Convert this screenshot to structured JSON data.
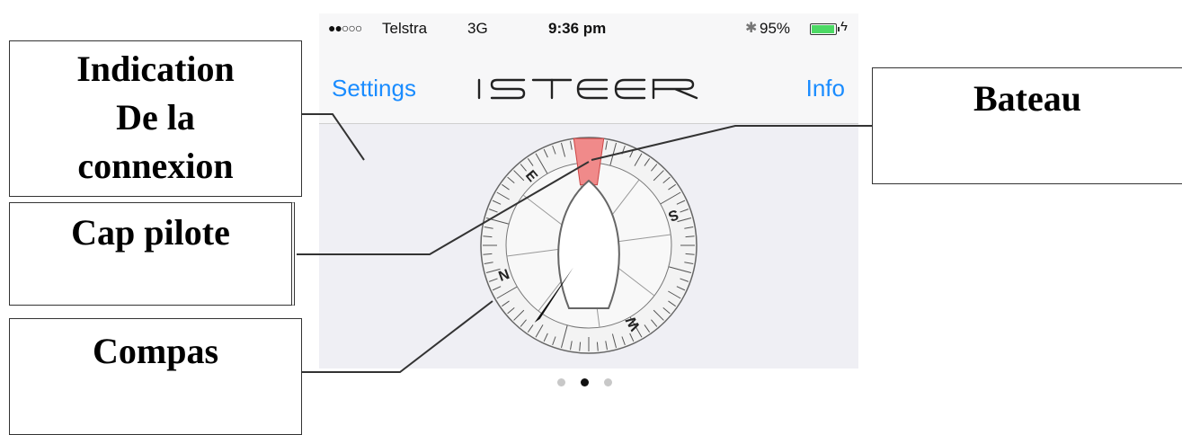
{
  "status_bar": {
    "signal": "●●○○○",
    "carrier": "Telstra",
    "network": "3G",
    "time": "9:36 pm",
    "bluetooth": "bluetooth-icon",
    "battery": "95%",
    "battery_level": 0.95
  },
  "nav": {
    "left": "Settings",
    "title": "iSTEER",
    "right": "Info"
  },
  "compass": {
    "letters": [
      "N",
      "E",
      "S",
      "W"
    ],
    "heading_marker_color": "#f08a8a"
  },
  "connection_color": "#a6ec2a",
  "pager": {
    "count": 3,
    "active_index": 1
  },
  "callouts": {
    "connexion": "Indication\nDe la\nconnexion",
    "cap_pilote": "Cap pilote",
    "compas": "Compas",
    "bateau": "Bateau"
  },
  "colors": {
    "accent": "#1a8cff"
  }
}
